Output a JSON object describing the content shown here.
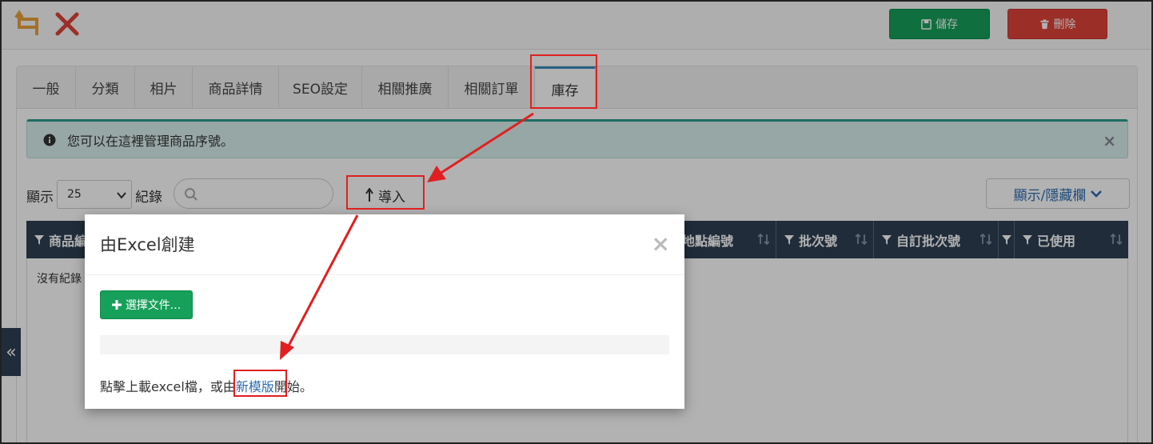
{
  "toolbar": {
    "undo_icon": "undo-icon",
    "close_icon": "close-icon",
    "save_label": "儲存",
    "delete_label": "刪除",
    "colors": {
      "save": "#16a05a",
      "delete": "#e0423a",
      "undo": "#e8a33b",
      "close": "#e0423a"
    }
  },
  "tabs": [
    {
      "label": "一般",
      "active": false
    },
    {
      "label": "分類",
      "active": false
    },
    {
      "label": "相片",
      "active": false
    },
    {
      "label": "商品詳情",
      "active": false
    },
    {
      "label": "SEO設定",
      "active": false
    },
    {
      "label": "相關推廣",
      "active": false
    },
    {
      "label": "相關訂單",
      "active": false
    },
    {
      "label": "庫存",
      "active": true
    }
  ],
  "alert": {
    "text": "您可以在這裡管理商品序號。",
    "close": "×"
  },
  "controls": {
    "show_label": "顯示",
    "page_size": "25",
    "records_label": "紀錄",
    "search_placeholder": "",
    "import_label": "導入",
    "colvis_label": "顯示/隱藏欄"
  },
  "table": {
    "columns": [
      "商品編",
      "地點編號",
      "批次號",
      "自訂批次號",
      "已使用"
    ],
    "empty_text": "沒有紀錄"
  },
  "side_toggle": "«",
  "modal": {
    "title": "由Excel創建",
    "close": "×",
    "choose_file_label": "選擇文件...",
    "hint_before": "點擊上載excel檔，或由",
    "hint_link": "新模版",
    "hint_after": "開始。"
  }
}
